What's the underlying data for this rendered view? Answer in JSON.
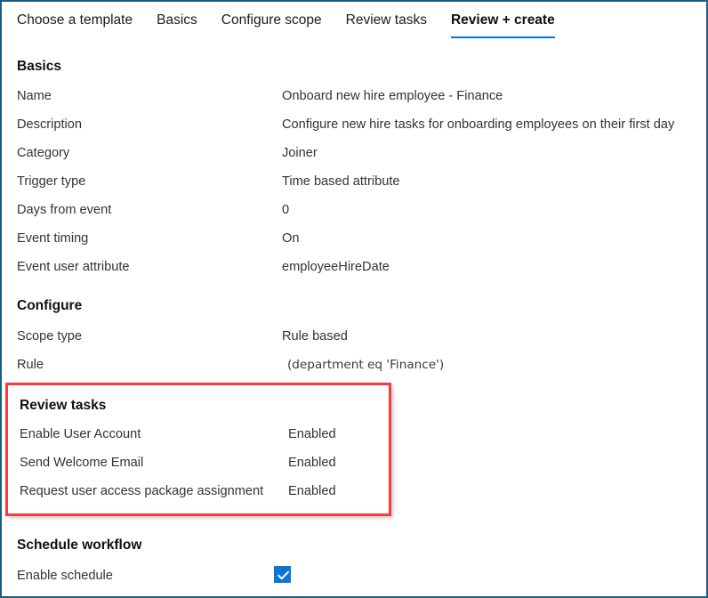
{
  "colors": {
    "frame_border": "#1d5e80",
    "tab_accent": "#0078d4",
    "highlight_box": "#fb3b3b",
    "checkbox_fill": "#0c76d1"
  },
  "tabs": [
    {
      "label": "Choose a template",
      "selected": false
    },
    {
      "label": "Basics",
      "selected": false
    },
    {
      "label": "Configure scope",
      "selected": false
    },
    {
      "label": "Review tasks",
      "selected": false
    },
    {
      "label": "Review + create",
      "selected": true
    }
  ],
  "sections": {
    "basics": {
      "heading": "Basics",
      "rows": [
        {
          "label": "Name",
          "value": "Onboard new hire employee - Finance"
        },
        {
          "label": "Description",
          "value": "Configure new hire tasks for onboarding employees on their first day"
        },
        {
          "label": "Category",
          "value": "Joiner"
        },
        {
          "label": "Trigger type",
          "value": "Time based attribute"
        },
        {
          "label": "Days from event",
          "value": "0"
        },
        {
          "label": "Event timing",
          "value": "On"
        },
        {
          "label": "Event user attribute",
          "value": "employeeHireDate"
        }
      ]
    },
    "configure": {
      "heading": "Configure",
      "rows": [
        {
          "label": "Scope type",
          "value": "Rule based"
        },
        {
          "label": "Rule",
          "value": "(department eq 'Finance')"
        }
      ]
    },
    "review_tasks": {
      "heading": "Review tasks",
      "rows": [
        {
          "label": "Enable User Account",
          "value": "Enabled"
        },
        {
          "label": "Send Welcome Email",
          "value": "Enabled"
        },
        {
          "label": "Request user access package assignment",
          "value": "Enabled"
        }
      ]
    },
    "schedule_workflow": {
      "heading": "Schedule workflow",
      "rows": [
        {
          "label": "Enable schedule",
          "value": ""
        }
      ],
      "enable_schedule_checked": true
    }
  }
}
